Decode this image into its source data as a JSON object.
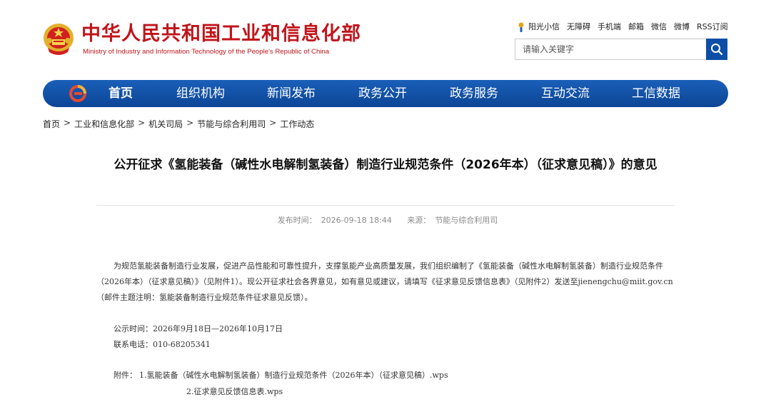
{
  "header": {
    "title_cn": "中华人民共和国工业和信息化部",
    "title_en": "Ministry of Industry and Information Technology of the People's Republic of China",
    "top_links": [
      "阳光小信",
      "无障碍",
      "手机端",
      "邮箱",
      "微信",
      "微博",
      "RSS订阅"
    ],
    "search": {
      "placeholder": "请输入关键字"
    }
  },
  "nav": {
    "items": [
      "首页",
      "组织机构",
      "新闻发布",
      "政务公开",
      "政务服务",
      "互动交流",
      "工信数据"
    ],
    "active": "首页",
    "color": "#0f4fa8"
  },
  "breadcrumb": {
    "items": [
      "首页",
      "工业和信息化部",
      "机关司局",
      "节能与综合利用司",
      "工作动态"
    ],
    "separator": ">"
  },
  "article": {
    "title": "公开征求《氢能装备（碱性水电解制氢装备）制造行业规范条件（2026年本）（征求意见稿）》的意见",
    "publish_label": "发布时间：",
    "publish_time": "2026-09-18 18:44",
    "source_label": "来源：",
    "source": "节能与综合利用司",
    "body": "为规范氢能装备制造行业发展，促进产品性能和可靠性提升，支撑氢能产业高质量发展，我们组织编制了《氢能装备（碱性水电解制氢装备）制造行业规范条件（2026年本）（征求意见稿）》（见附件1）。现公开征求社会各界意见，如有意见或建议，请填写《征求意见反馈信息表》（见附件2）发送至jienengchu@miit.gov.cn（邮件主题注明：氢能装备制造行业规范条件征求意见反馈）。",
    "period": "公示时间：2026年9月18日—2026年10月17日",
    "phone": "联系电话：010-68205341",
    "attachment_label": "附件：",
    "attachments": [
      "1.氢能装备（碱性水电解制氢装备）制造行业规范条件（2026年本）（征求意见稿）.wps",
      "2.征求意见反馈信息表.wps"
    ]
  },
  "colors": {
    "brand_red": "#c0151b",
    "brand_blue": "#0d4ea6"
  }
}
